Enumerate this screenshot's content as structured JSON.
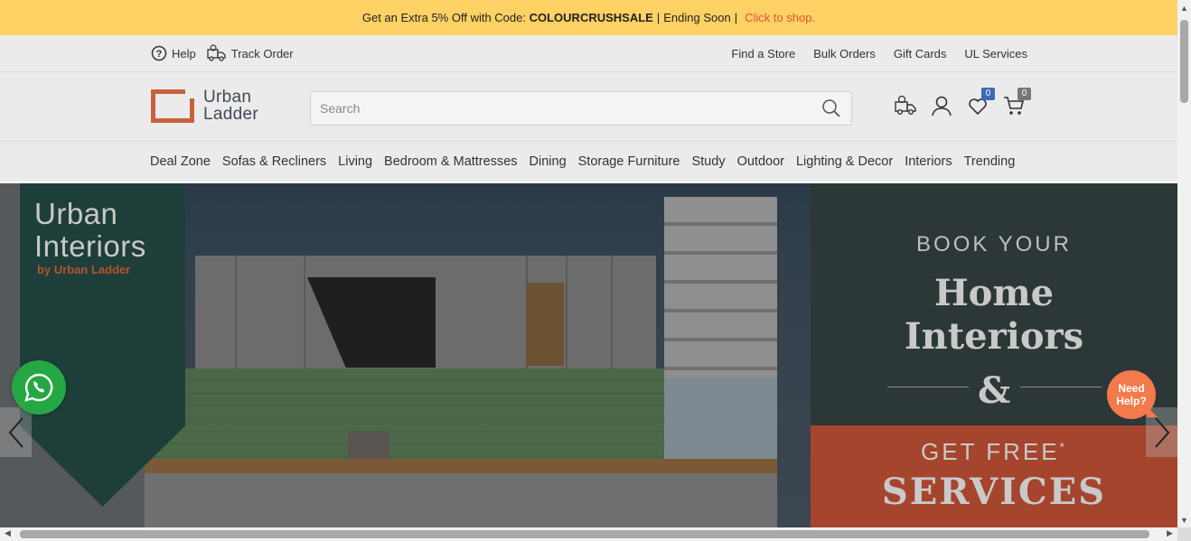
{
  "promo": {
    "text_prefix": "Get an Extra 5% Off with Code:",
    "code": "COLOURCRUSHSALE",
    "separator": "|",
    "ending": "Ending Soon",
    "separator2": "|",
    "link": "Click to shop."
  },
  "utility": {
    "help": "Help",
    "track_order": "Track Order",
    "right_links": [
      "Find a Store",
      "Bulk Orders",
      "Gift Cards",
      "UL Services"
    ]
  },
  "logo": {
    "line1": "Urban",
    "line2": "Ladder"
  },
  "search": {
    "placeholder": "Search",
    "value": ""
  },
  "header_icons": {
    "wishlist_count": "0",
    "cart_count": "0"
  },
  "nav": [
    "Deal Zone",
    "Sofas & Recliners",
    "Living",
    "Bedroom & Mattresses",
    "Dining",
    "Storage Furniture",
    "Study",
    "Outdoor",
    "Lighting & Decor",
    "Interiors",
    "Trending"
  ],
  "hero": {
    "ribbon_title_1": "Urban",
    "ribbon_title_2": "Interiors",
    "ribbon_sub": "by Urban Ladder",
    "book": "BOOK YOUR",
    "home": "Home",
    "interiors": "Interiors",
    "amp": "&",
    "get_free": "GET FREE",
    "get_free_mark": "*",
    "services": "SERVICES"
  },
  "floating": {
    "need_help_1": "Need",
    "need_help_2": "Help?"
  },
  "colors": {
    "promo_bg": "#fed164",
    "promo_link": "#e2533a",
    "whatsapp": "#25a844",
    "need_help": "#f47a4d",
    "brand": "#c8623c"
  }
}
